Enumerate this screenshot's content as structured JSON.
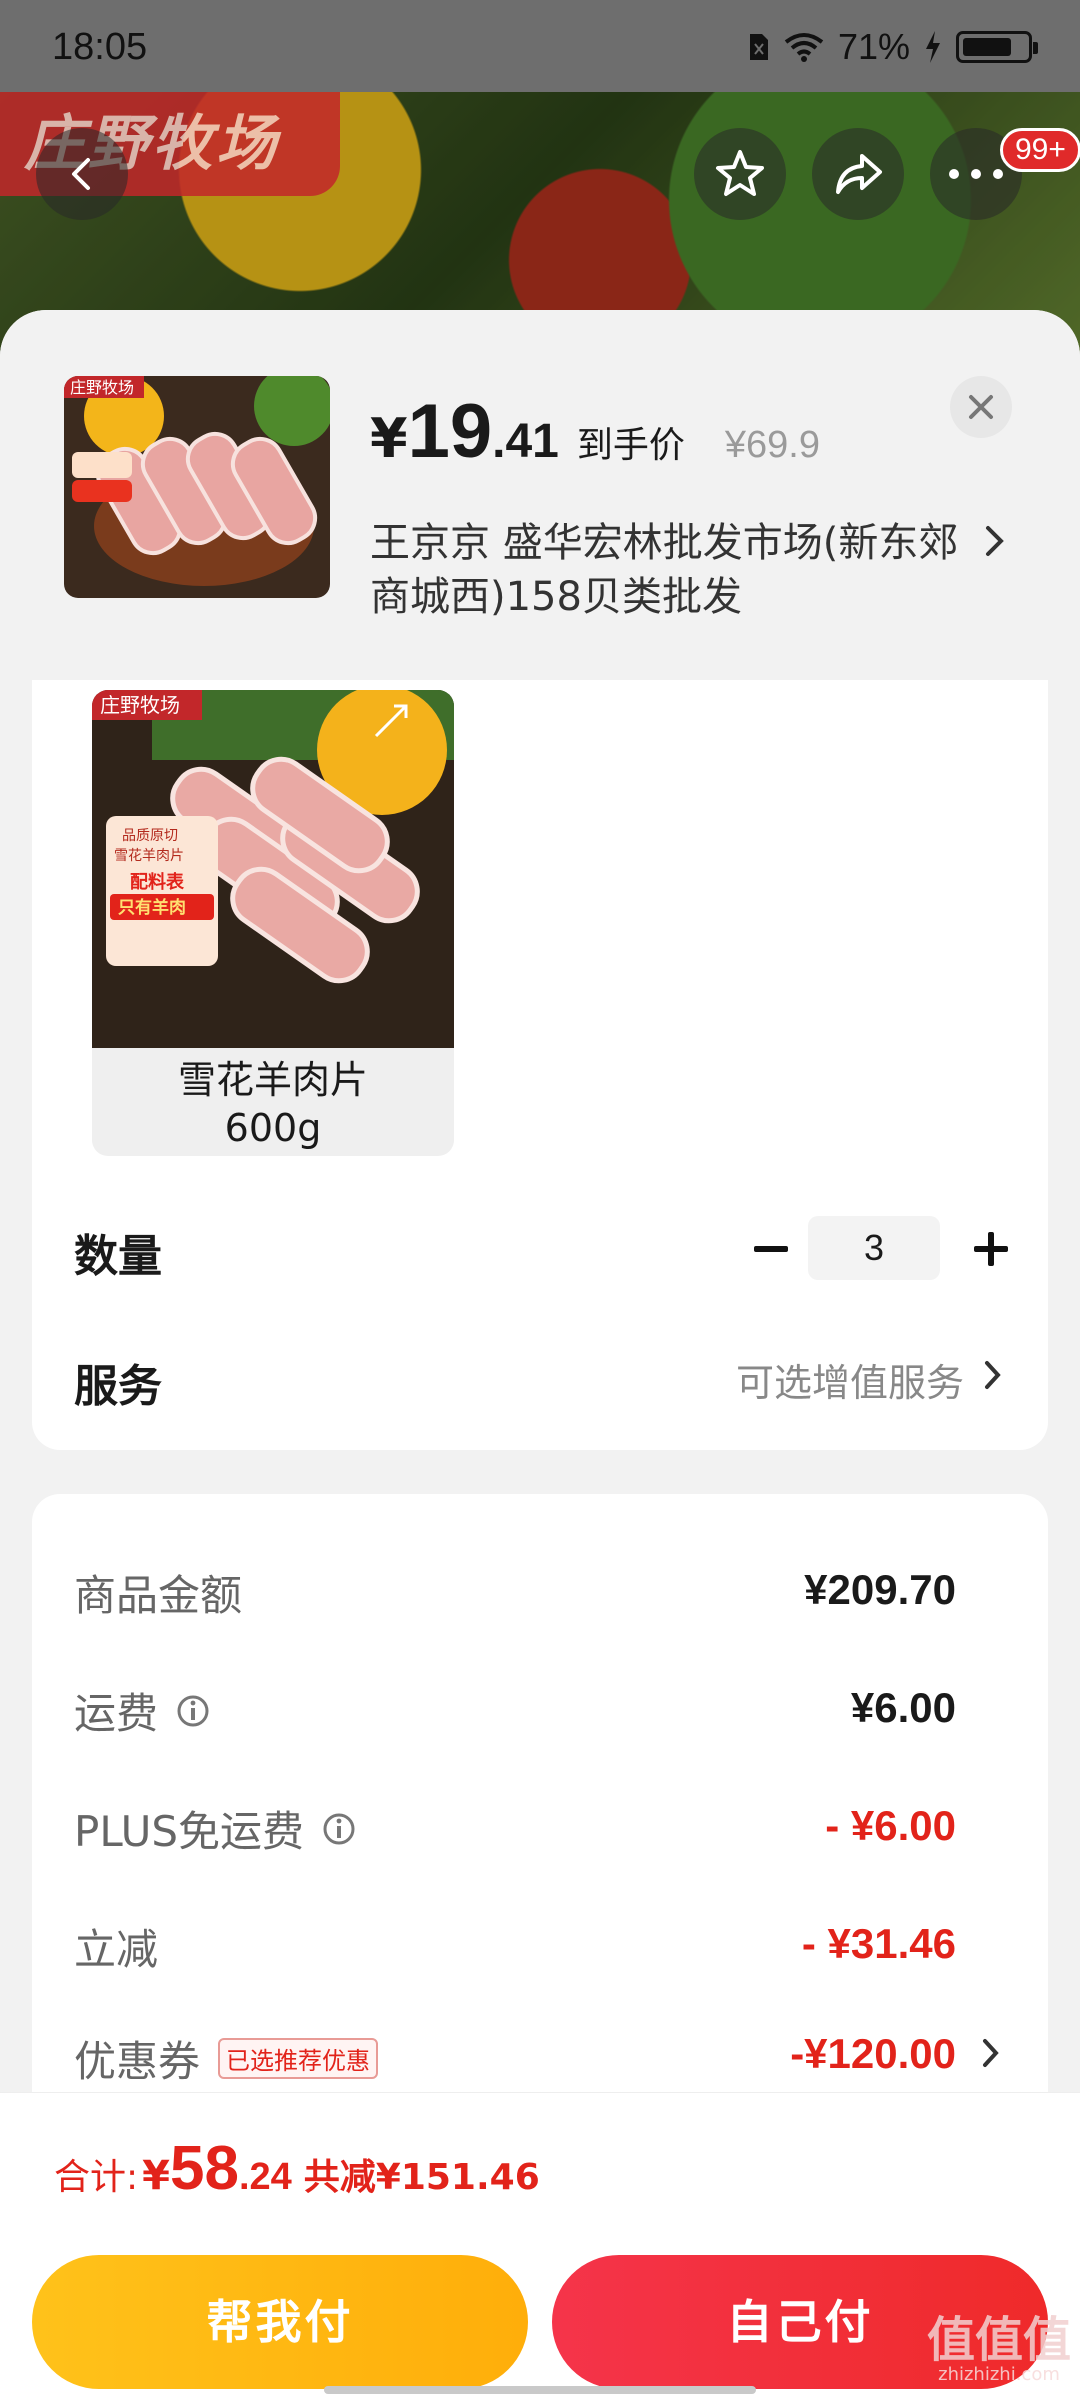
{
  "status_bar": {
    "time": "18:05",
    "battery": "71%"
  },
  "header": {
    "brand_banner": "庄野牧场",
    "notification_badge": "99+"
  },
  "product": {
    "price_currency": "¥",
    "price_integer": "19",
    "price_decimal": ".41",
    "price_label": "到手价",
    "original_price": "¥69.9",
    "shop_name": "王京京  盛华宏林批发市场(新东郊商城西)158贝类批发"
  },
  "variant": {
    "name": "雪花羊肉片",
    "weight": "600g",
    "brand": "庄野牧场",
    "packaging_text_1": "品质原切",
    "packaging_text_2": "雪花羊肉片",
    "packaging_text_3": "配料表",
    "packaging_text_4": "只有羊肉"
  },
  "options": {
    "quantity_label": "数量",
    "quantity_value": "3",
    "service_label": "服务",
    "service_value": "可选增值服务"
  },
  "fees": {
    "goods_label": "商品金额",
    "goods_value": "¥209.70",
    "shipping_label": "运费",
    "shipping_value": "¥6.00",
    "plus_label": "PLUS免运费",
    "plus_value": "- ¥6.00",
    "discount_label": "立减",
    "discount_value": "- ¥31.46",
    "coupon_label": "优惠券",
    "coupon_tag": "已选推荐优惠",
    "coupon_value": "-¥120.00"
  },
  "footer": {
    "total_label": "合计:",
    "total_currency": "¥",
    "total_integer": "58",
    "total_decimal": ".24",
    "total_saved": "共减¥151.46",
    "help_pay_button": "帮我付",
    "self_pay_button": "自己付"
  },
  "watermark": {
    "text": "值值值",
    "domain": "zhizhizhi.com"
  },
  "colors": {
    "accent_red": "#e2231a",
    "button_yellow": "#ffb812",
    "button_red": "#f22f3d"
  }
}
